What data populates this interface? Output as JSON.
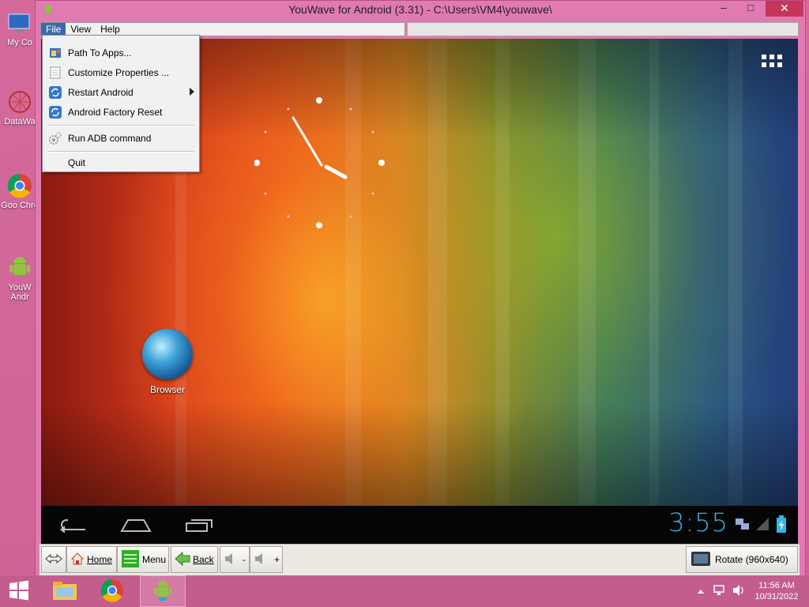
{
  "window": {
    "title": "YouWave for Android (3.31) - C:\\Users\\VM4\\youwave\\",
    "minimize": "–",
    "maximize": "□",
    "close": "✕"
  },
  "desktop": {
    "icons": [
      {
        "label": "My Co",
        "icon": "computer-icon"
      },
      {
        "label": "DataWa",
        "icon": "datawave-icon"
      },
      {
        "label": "Goo Chro",
        "icon": "chrome-icon"
      },
      {
        "label": "YouW Andr",
        "icon": "youwave-android-icon"
      }
    ]
  },
  "menubar": {
    "items": [
      {
        "label": "File",
        "active": true
      },
      {
        "label": "View",
        "active": false
      },
      {
        "label": "Help",
        "active": false
      }
    ]
  },
  "file_menu": {
    "items": [
      {
        "label": "Path To Apps...",
        "icon": "folder-path-icon"
      },
      {
        "label": "Customize Properties ...",
        "icon": "properties-icon"
      },
      {
        "label": "Restart Android",
        "icon": "refresh-icon",
        "submenu": true
      },
      {
        "label": "Android Factory Reset",
        "icon": "refresh-icon"
      },
      {
        "label": "Run ADB command",
        "icon": "gear-icon"
      },
      {
        "label": "Quit",
        "icon": ""
      }
    ]
  },
  "android": {
    "shortcut_label": "Browser",
    "nav_time": "3:55",
    "accent": "#33b5e5"
  },
  "toolbar": {
    "home_label": "Home",
    "menu_label": "Menu",
    "back_label": "Back",
    "vol_down_label": "-",
    "vol_up_label": "+",
    "rotate_label": "Rotate (960x640)"
  },
  "taskbar": {
    "time": "11:56 AM",
    "date": "10/31/2022"
  }
}
